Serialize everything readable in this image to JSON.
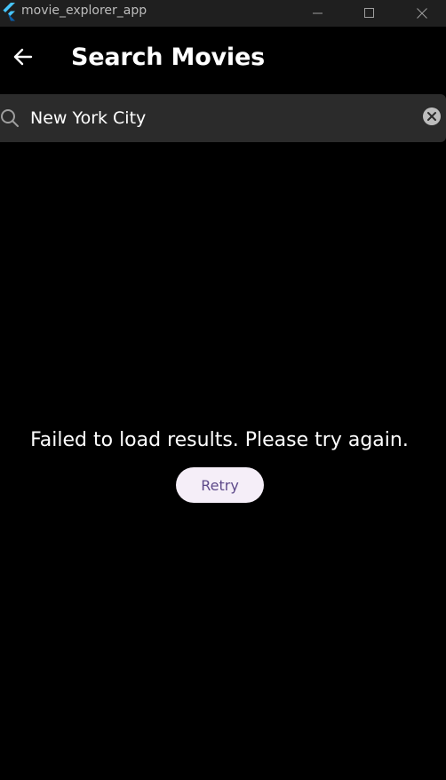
{
  "window": {
    "title": "movie_explorer_app",
    "icons": [
      "flutter-logo-icon",
      "minimize-icon",
      "maximize-icon",
      "close-icon"
    ]
  },
  "appbar": {
    "title": "Search Movies",
    "back_icon": "arrow-left-icon"
  },
  "search": {
    "value": "New York City",
    "placeholder": "",
    "search_icon": "search-icon",
    "clear_icon": "clear-circle-icon"
  },
  "error": {
    "message": "Failed to load results. Please try again.",
    "retry_label": "Retry"
  },
  "colors": {
    "background": "#000000",
    "titlebar": "#1f1f1f",
    "searchbar": "#2b2b2b",
    "retry_bg": "#f5eef8",
    "retry_text": "#5e4a8a"
  }
}
